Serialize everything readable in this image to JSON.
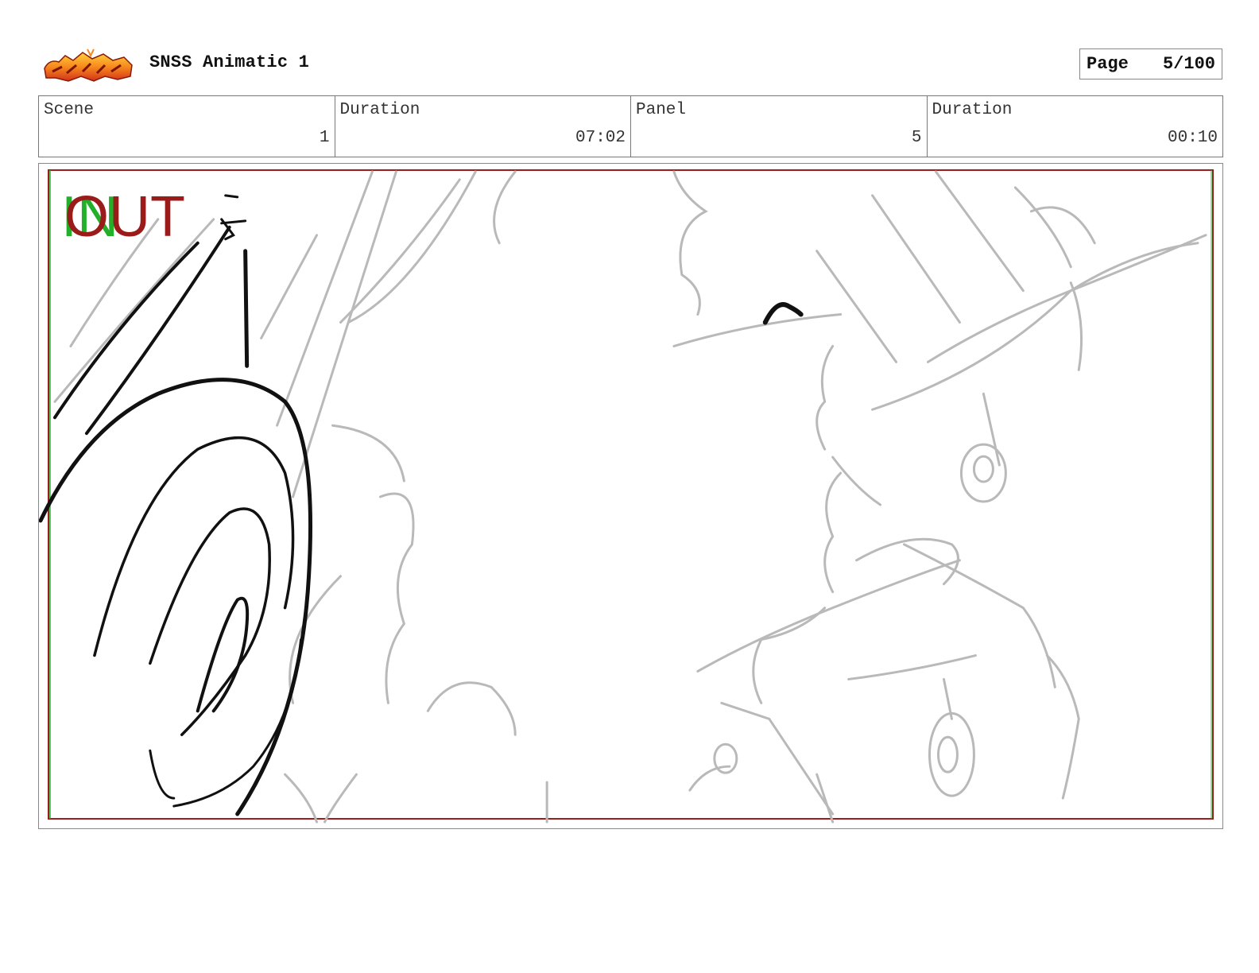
{
  "header": {
    "title": "SNSS Animatic 1",
    "page_label": "Page",
    "page_value": "5/100"
  },
  "info": [
    {
      "label": "Scene",
      "value": "1"
    },
    {
      "label": "Duration",
      "value": "07:02"
    },
    {
      "label": "Panel",
      "value": "5"
    },
    {
      "label": "Duration",
      "value": "00:10"
    }
  ],
  "panel": {
    "in_marker": "IN",
    "out_marker": "OUT",
    "in_color": "#22b02a",
    "out_color": "#9b1a1a",
    "safe_frame_color": "#9b1a1a"
  }
}
